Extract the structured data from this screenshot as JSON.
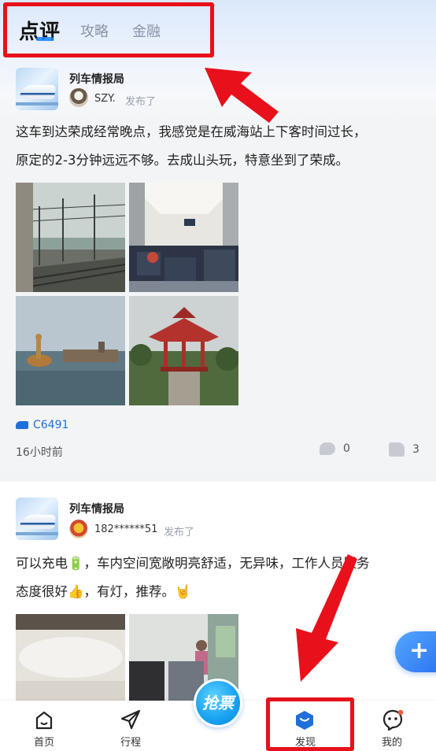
{
  "tabs": [
    {
      "label": "点评",
      "active": true
    },
    {
      "label": "攻略",
      "active": false
    },
    {
      "label": "金融",
      "active": false
    }
  ],
  "posts": [
    {
      "author": "列车情报局",
      "user": "SZY.",
      "published_label": "发布了",
      "text_line1": "这车到达荣成经常晚点，我感觉是在威海站上下客时间过长，",
      "text_line2": "原定的2-3分钟远远不够。去成山头玩，特意坐到了荣成。",
      "train_tag": "C6491",
      "time": "16小时前",
      "comments": "0",
      "likes": "3"
    },
    {
      "author": "列车情报局",
      "user": "182******51",
      "published_label": "发布了",
      "text_line1": "可以充电🔋，车内空间宽敞明亮舒适，无异味，工作人员服务",
      "text_line2": "态度很好👍，有灯，推荐。🤘"
    }
  ],
  "bottom_nav": [
    {
      "label": "首页",
      "icon": "home-icon"
    },
    {
      "label": "行程",
      "icon": "paper-plane-icon"
    },
    {
      "label": "抢票",
      "icon": "grab-ticket-icon"
    },
    {
      "label": "发现",
      "icon": "discover-icon",
      "active": true
    },
    {
      "label": "我的",
      "icon": "profile-icon"
    }
  ],
  "fab_label": "+",
  "colors": {
    "accent": "#1e6fd9",
    "annotation": "#e8101a"
  }
}
